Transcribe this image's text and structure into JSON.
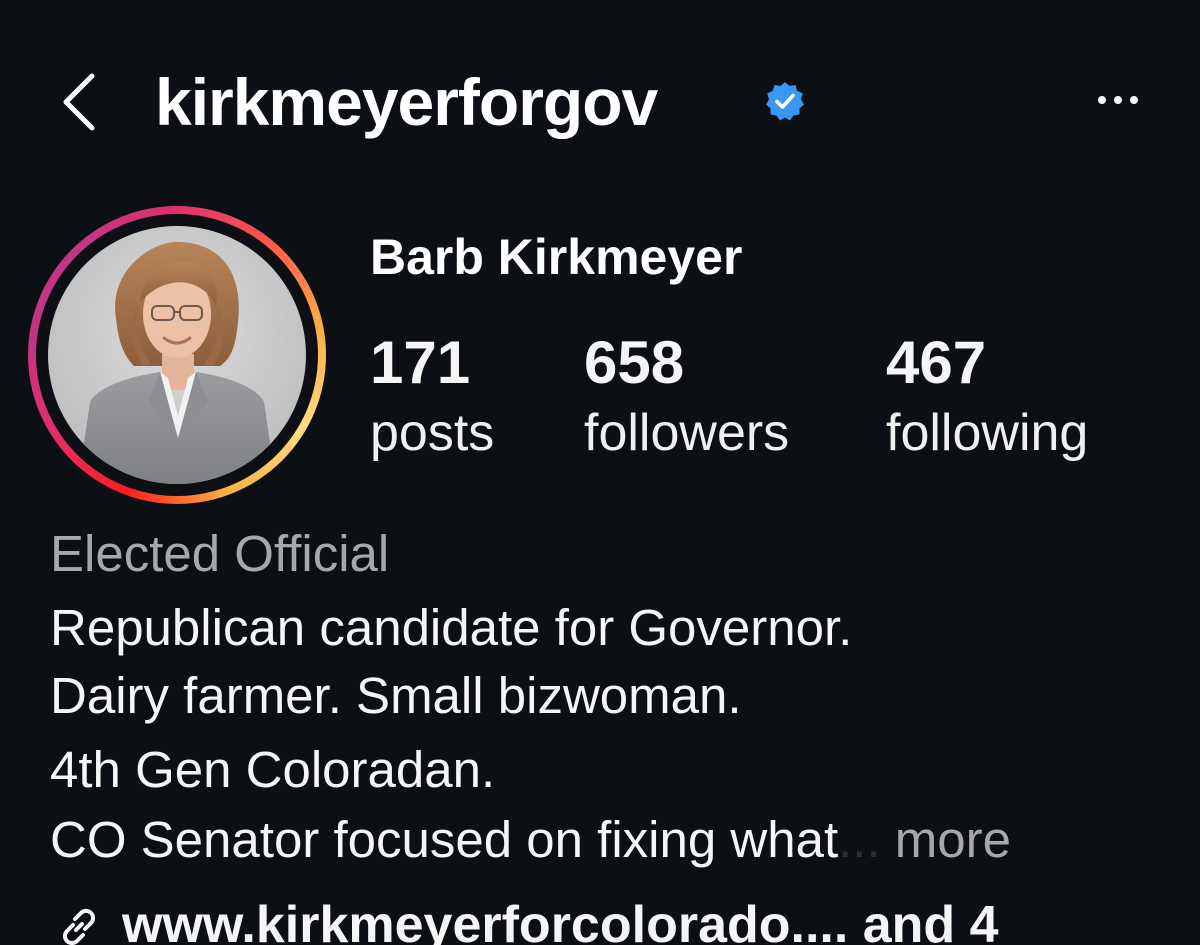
{
  "header": {
    "username": "kirkmeyerforgov",
    "verified": true,
    "back_icon": "chevron-left-icon",
    "more_icon": "more-horizontal-icon"
  },
  "profile": {
    "display_name": "Barb Kirkmeyer",
    "has_story": true
  },
  "stats": {
    "posts": {
      "count": "171",
      "label": "posts"
    },
    "followers": {
      "count": "658",
      "label": "followers"
    },
    "following": {
      "count": "467",
      "label": "following"
    }
  },
  "bio": {
    "category": "Elected Official",
    "lines": [
      "Republican candidate for Governor.",
      "Dairy farmer. Small bizwoman.",
      "4th Gen Coloradan.",
      "CO Senator focused on fixing what"
    ],
    "truncation": "...",
    "more_label": "more"
  },
  "link": {
    "icon": "link-icon",
    "text": "www.kirkmeyerforcolorado....  and 4"
  },
  "colors": {
    "background": "#0c0f14",
    "verified_blue": "#3897f0",
    "muted_text": "#a8a8a8"
  }
}
